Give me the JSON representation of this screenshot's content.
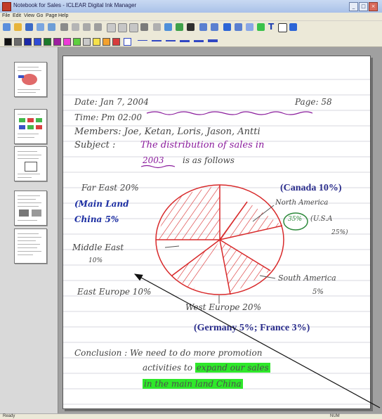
{
  "window": {
    "title": "Notebook for Sales - ICLEAR Digital Ink Manager",
    "controls": [
      "_",
      "□",
      "×"
    ]
  },
  "menubar": {
    "items": [
      "File",
      "Edit",
      "View",
      "Go",
      "Page",
      "Help"
    ]
  },
  "toolbar": {
    "text_tool_label": "T"
  },
  "colors": {
    "ink_gray": "#444444",
    "ink_blue": "#1d2fa3",
    "ink_purple": "#8a1b9c",
    "pie_red": "#d8292a",
    "highlight_green": "#2ee82a",
    "typed_navy": "#2a2d8c"
  },
  "palette": [
    "#111111",
    "#6b6b6b",
    "#1b28a8",
    "#2f4bd6",
    "#1c7a2a",
    "#9e1fa0",
    "#ed3ad7",
    "#5ecf3e",
    "#c8c8c8",
    "#f6e14a",
    "#f3a12e",
    "#d83c3c"
  ],
  "sidebar": {
    "thumbnails": [
      "page-1",
      "page-2",
      "page-3",
      "page-4",
      "page-5"
    ]
  },
  "note": {
    "date": "Date: Jan 7, 2004",
    "time": "Time: Pm 02:00",
    "page": "Page: 58",
    "members": "Members: Joe, Ketan, Loris, Jason, Antti",
    "subject_label": "Subject :",
    "subject_underlined": "The distribution of sales in",
    "subject_year": "2003",
    "subject_rest": "is as follows",
    "far_east": "Far East 20%",
    "mainland": "(Main Land",
    "china": "China 5%",
    "canada": "(Canada 10%)",
    "north_america": "North America",
    "north_pct": "35%",
    "usa": "(U.S.A",
    "usa_pct": "25%)",
    "middle_east": "Middle East",
    "middle_pct": "10%",
    "south_america": "South America",
    "south_pct": "5%",
    "east_europe": "East Europe 10%",
    "west_europe": "West Europe 20%",
    "germany_france": "(Germany 5%; France 3%)",
    "conclusion_prefix": "Conclusion : We need to do more promotion",
    "conclusion_line2_prefix": "activities to",
    "conclusion_line2_highlight": "expand our sales",
    "conclusion_line3_highlight": "in the main land China"
  },
  "statusbar": {
    "left": "Ready",
    "right": "NUM"
  }
}
